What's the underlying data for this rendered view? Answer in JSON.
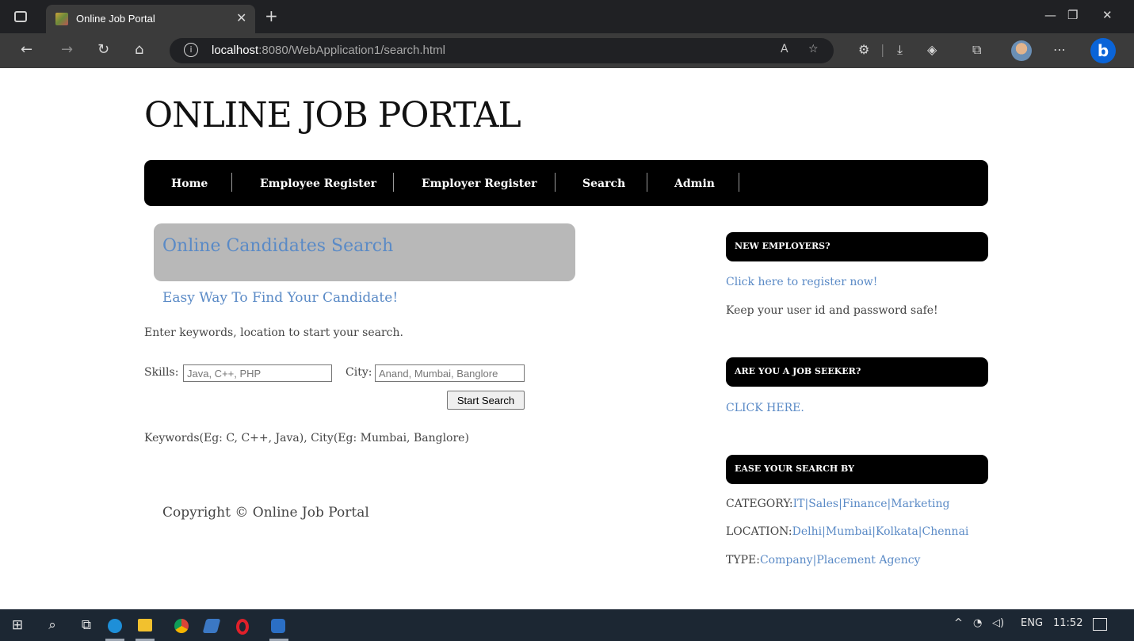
{
  "browser": {
    "tab_title": "Online Job Portal",
    "url_host": "localhost",
    "url_path": ":8080/WebApplication1/search.html"
  },
  "site": {
    "title": "ONLINE JOB PORTAL",
    "menu": [
      "Home",
      "Employee Register",
      "Employer Register",
      "Search",
      "Admin"
    ]
  },
  "search": {
    "heading": "Online Candidates Search",
    "subheading": "Easy Way To Find Your Candidate!",
    "intro": "Enter keywords, location to start your search.",
    "skills_label": "Skills:",
    "skills_placeholder": "Java, C++, PHP",
    "city_label": "City:",
    "city_placeholder": "Anand, Mumbai, Banglore",
    "button_label": "Start Search",
    "hint": "Keywords(Eg: C, C++, Java), City(Eg: Mumbai, Banglore)"
  },
  "footer": {
    "copyright": "Copyright © Online Job Portal"
  },
  "sidebar": {
    "employers": {
      "heading": "NEW EMPLOYERS?",
      "link": "Click here to register now!",
      "note": "Keep your user id and password safe!"
    },
    "seeker": {
      "heading": "ARE YOU A JOB SEEKER?",
      "link": "CLICK HERE."
    },
    "ease": {
      "heading": "EASE YOUR SEARCH BY",
      "category_label": "CATEGORY:",
      "categories": [
        "IT",
        "Sales",
        "Finance",
        "Marketing"
      ],
      "location_label": "LOCATION:",
      "locations": [
        "Delhi",
        "Mumbai",
        "Kolkata",
        "Chennai"
      ],
      "type_label": "TYPE:",
      "types": [
        "Company",
        "Placement Agency"
      ]
    }
  },
  "taskbar": {
    "language": "ENG",
    "time": "11:52"
  }
}
